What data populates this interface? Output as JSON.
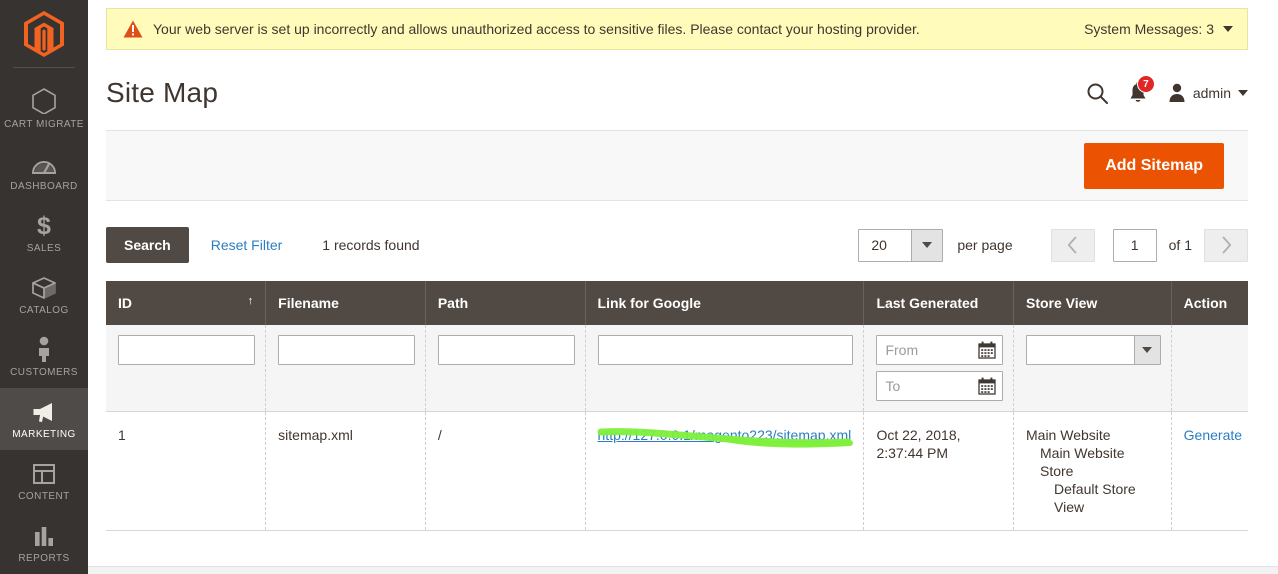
{
  "sidebar": {
    "logo_name": "magento-logo",
    "items": [
      {
        "label": "CART MIGRATE",
        "icon": "hexagon-icon",
        "active": false
      },
      {
        "label": "DASHBOARD",
        "icon": "gauge-icon",
        "active": false
      },
      {
        "label": "SALES",
        "icon": "dollar-icon",
        "active": false
      },
      {
        "label": "CATALOG",
        "icon": "box-icon",
        "active": false
      },
      {
        "label": "CUSTOMERS",
        "icon": "person-icon",
        "active": false
      },
      {
        "label": "MARKETING",
        "icon": "megaphone-icon",
        "active": true
      },
      {
        "label": "CONTENT",
        "icon": "layout-icon",
        "active": false
      },
      {
        "label": "REPORTS",
        "icon": "bar-chart-icon",
        "active": false
      }
    ]
  },
  "system_message": {
    "icon": "warning-triangle-icon",
    "text": "Your web server is set up incorrectly and allows unauthorized access to sensitive files. Please contact your hosting provider.",
    "toggle_label": "System Messages: 3",
    "background": "#fffbbb",
    "warning_color": "#e04f16"
  },
  "header": {
    "title": "Site Map",
    "search_icon": "search-icon",
    "notifications_icon": "bell-icon",
    "notifications_count": "7",
    "notifications_badge_color": "#e22626",
    "user_icon": "user-avatar-icon",
    "user_name": "admin"
  },
  "action_panel": {
    "add_sitemap_label": "Add Sitemap",
    "accent_color": "#eb5202"
  },
  "grid_toolbar": {
    "search_label": "Search",
    "reset_filter_label": "Reset Filter",
    "records_found": "1 records found",
    "per_page_value": "20",
    "per_page_label": "per page",
    "prev_icon": "chevron-left-icon",
    "next_icon": "chevron-right-icon",
    "current_page": "1",
    "of_pages": "of 1"
  },
  "grid": {
    "columns": [
      {
        "label": "ID",
        "sort": "↑"
      },
      {
        "label": "Filename",
        "sort": ""
      },
      {
        "label": "Path",
        "sort": ""
      },
      {
        "label": "Link for Google",
        "sort": ""
      },
      {
        "label": "Last Generated",
        "sort": ""
      },
      {
        "label": "Store View",
        "sort": ""
      },
      {
        "label": "Action",
        "sort": ""
      }
    ],
    "filters": {
      "id": "",
      "filename": "",
      "path": "",
      "link_for_google": "",
      "last_generated_from_placeholder": "From",
      "last_generated_to_placeholder": "To",
      "store_view": "",
      "calendar_icon": "calendar-icon",
      "dropdown_icon": "chevron-down-icon"
    },
    "rows": [
      {
        "id": "1",
        "filename": "sitemap.xml",
        "path": "/",
        "link_for_google": "http://127.0.0.1/magento223/sitemap.xml",
        "last_generated": "Oct 22, 2018, 2:37:44 PM",
        "store_view_website": "Main Website",
        "store_view_store": "Main Website Store",
        "store_view_view": "Default Store View",
        "action": "Generate"
      }
    ]
  },
  "annotation": {
    "type": "highlighter-stroke",
    "color": "#7ef03c",
    "target": "link_for_google"
  }
}
